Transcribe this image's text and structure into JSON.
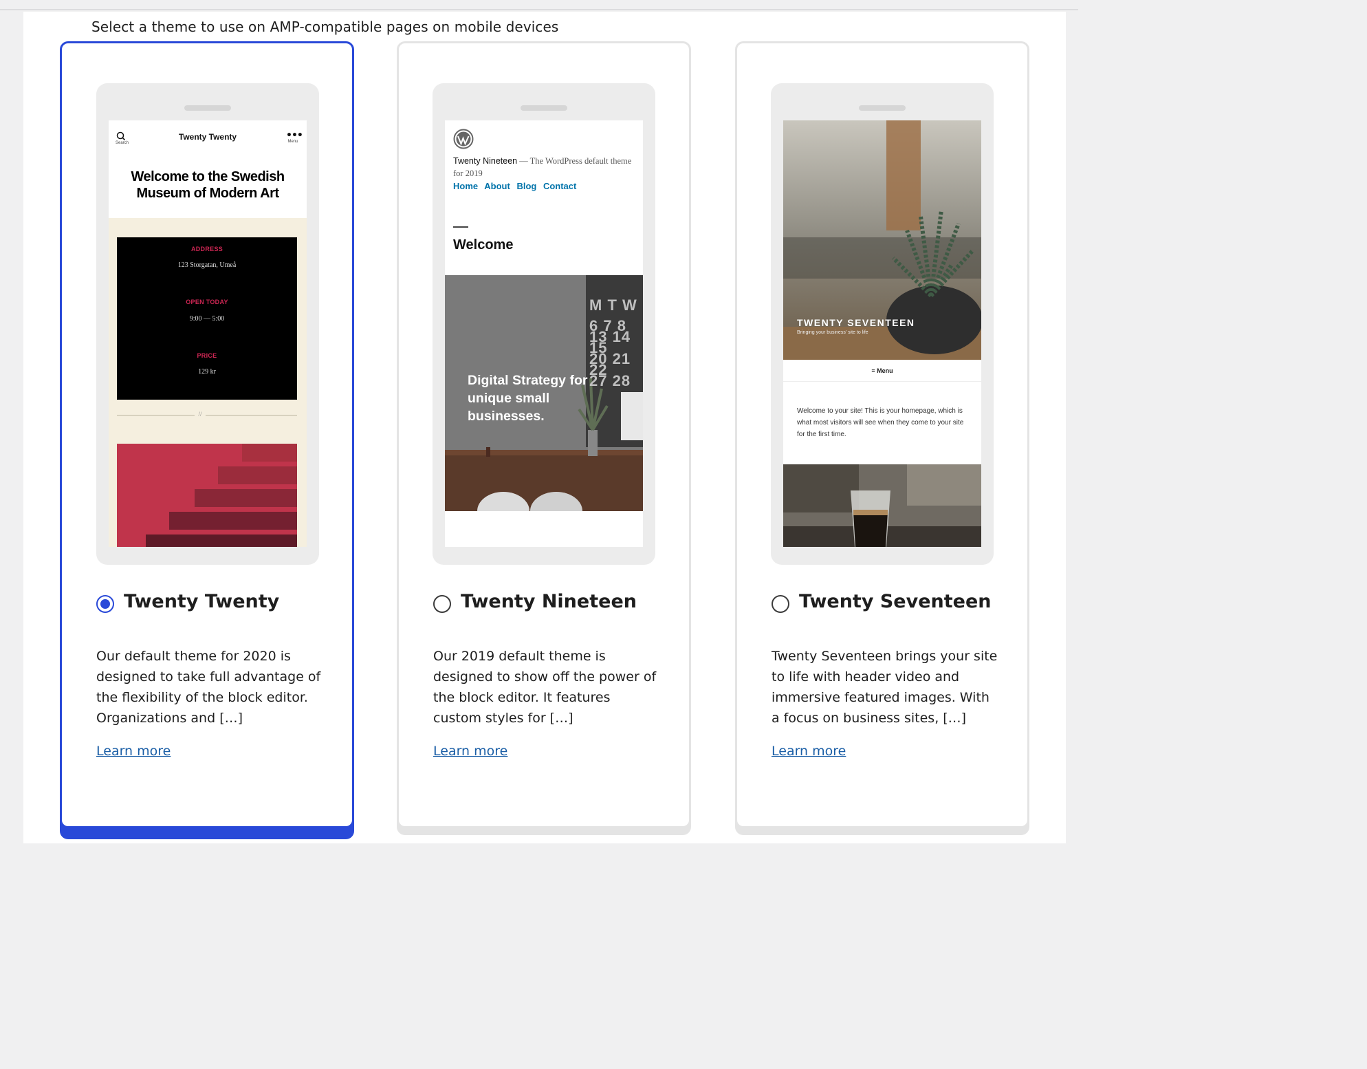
{
  "page": {
    "subtitle": "Select a theme to use on AMP-compatible pages on mobile devices"
  },
  "themes": [
    {
      "name": "Twenty Twenty",
      "selected": true,
      "description": "Our default theme for 2020 is designed to take full advantage of the flexibility of the block editor. Organizations and […]",
      "learn_more": "Learn more",
      "preview": {
        "search_label": "Search",
        "site_title": "Twenty Twenty",
        "menu_label": "Menu",
        "headline": "Welcome to the Swedish Museum of Modern Art",
        "address_label": "ADDRESS",
        "address_value": "123 Storgatan, Umeå",
        "open_label": "OPEN TODAY",
        "open_value": "9:00 — 5:00",
        "price_label": "PRICE",
        "price_value": "129 kr",
        "separator": "//"
      }
    },
    {
      "name": "Twenty Nineteen",
      "selected": false,
      "description": "Our 2019 default theme is designed to show off the power of the block editor. It features custom styles for […]",
      "learn_more": "Learn more",
      "preview": {
        "site_title": "Twenty Nineteen",
        "tagline": "— The WordPress default theme for 2019",
        "nav": [
          "Home",
          "About",
          "Blog",
          "Contact"
        ],
        "welcome": "Welcome",
        "headline": "Digital Strategy for unique small businesses.",
        "calendar_row1": "M T W",
        "calendar_row2": "6 7 8",
        "calendar_row3": "13 14 15",
        "calendar_row4": "20 21 22",
        "calendar_row5": "27 28"
      }
    },
    {
      "name": "Twenty Seventeen",
      "selected": false,
      "description": "Twenty Seventeen brings your site to life with header video and immersive featured images. With a focus on business sites, […]",
      "learn_more": "Learn more",
      "preview": {
        "site_title": "TWENTY SEVENTEEN",
        "tagline": "Bringing your business' site to life",
        "menu": "≡ Menu",
        "intro": "Welcome to your site! This is your homepage, which is what most visitors will see when they come to your site for the first time."
      }
    }
  ],
  "colors": {
    "selected_accent": "#2949d8",
    "link": "#1a5ea6",
    "card_border": "#e4e4e4"
  }
}
